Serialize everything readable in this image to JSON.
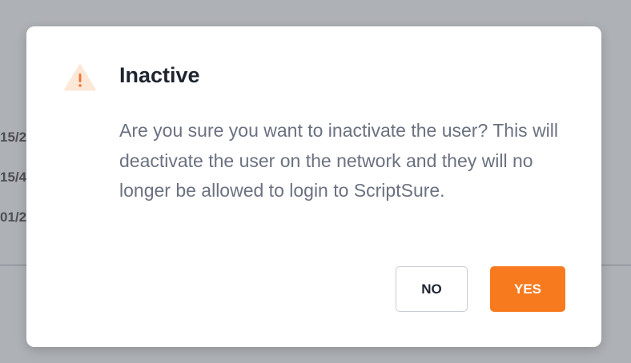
{
  "background": {
    "visible_fragments": [
      "15/2",
      "15/4",
      "01/2"
    ]
  },
  "dialog": {
    "title": "Inactive",
    "message": "Are you sure you want to inactivate the user? This will deactivate the user on the network and they will no longer be allowed to login to ScriptSure.",
    "icon": "warning-icon",
    "buttons": {
      "no_label": "NO",
      "yes_label": "YES"
    }
  },
  "colors": {
    "primary": "#f77a1e",
    "warning_bg": "#fde7d6",
    "warning_fg": "#f0722c",
    "overlay": "#aeb1b6"
  }
}
